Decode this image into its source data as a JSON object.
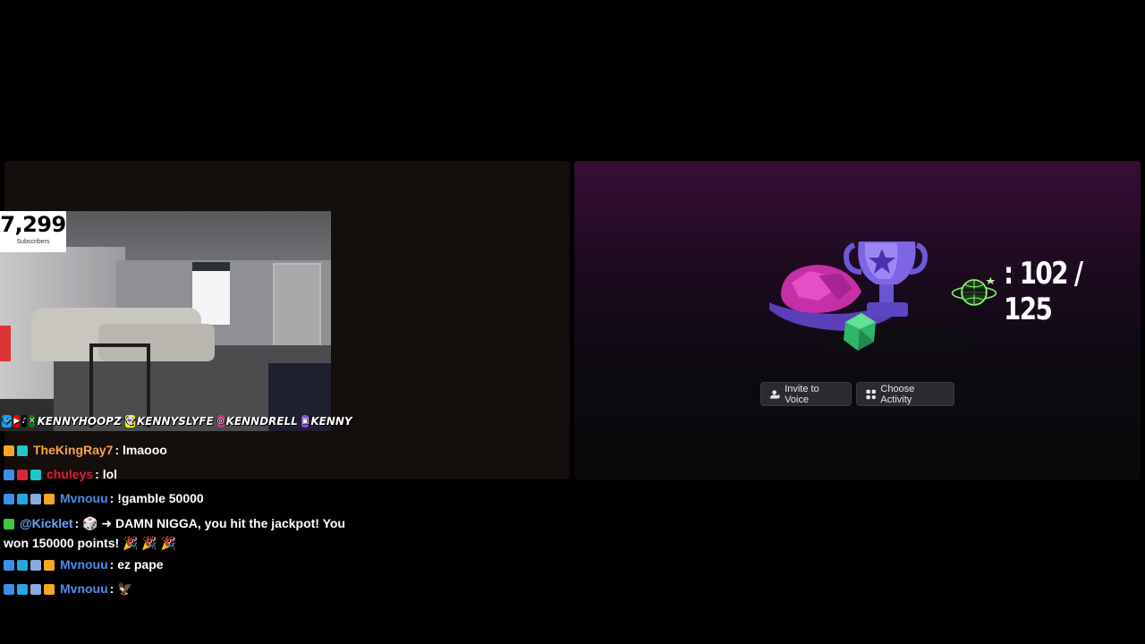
{
  "stream": {
    "subscribers": {
      "count": "7,299",
      "label": "Subscribers"
    },
    "socials": [
      {
        "icon": "twitter-icon",
        "color": "#1da1f2",
        "glyph": "🐦"
      },
      {
        "icon": "youtube-icon",
        "color": "#ff0000",
        "glyph": "▶"
      },
      {
        "icon": "tiktok-icon",
        "color": "#000000",
        "glyph": "♪"
      },
      {
        "icon": "xbox-icon",
        "color": "#107c10",
        "glyph": "✕",
        "handle": "KENNYHOOPZ"
      },
      {
        "icon": "snapchat-icon",
        "color": "#fffc00",
        "glyph": "👻",
        "handle": "KENNYSLYFE"
      },
      {
        "icon": "instagram-icon",
        "color": "#c13584",
        "glyph": "◎",
        "handle": "KENNDRELL"
      },
      {
        "icon": "twitch-icon",
        "color": "#9146ff",
        "glyph": "▣",
        "handle": "KENNY"
      }
    ]
  },
  "chat": [
    {
      "badges": [
        "#f5a623",
        "#1ec8c8"
      ],
      "badge_icons": [
        "sub-badge-icon",
        "gift-badge-icon"
      ],
      "user": "TheKingRay7",
      "color": "#f6a54a",
      "message": ": lmaooo"
    },
    {
      "badges": [
        "#3a8ee6",
        "#d9263a",
        "#1ec8c8"
      ],
      "badge_icons": [
        "prime-badge-icon",
        "bits-badge-icon",
        "gift-badge-icon"
      ],
      "user": "chuleys",
      "color": "#e21c2d",
      "message": ": lol"
    },
    {
      "badges": [
        "#3a8ee6",
        "#26a6e0",
        "#8ad",
        "#f5a623"
      ],
      "badge_icons": [
        "prime-badge-icon",
        "cube-badge-icon",
        "gem-badge-icon",
        "crown-badge-icon"
      ],
      "user": "Mvnouu",
      "color": "#4b8ee8",
      "message": ": !gamble 50000"
    },
    {
      "badges": [
        "#3fc63f"
      ],
      "badge_icons": [
        "verified-badge-icon"
      ],
      "user": "@Kicklet",
      "color": "#6aa6f0",
      "message": ": 🎲 ➜ DAMN NIGGA, you hit the jackpot! You won 150000 points! 🎉 🎉 🎉"
    },
    {
      "badges": [
        "#3a8ee6",
        "#26a6e0",
        "#8ad",
        "#f5a623"
      ],
      "badge_icons": [
        "prime-badge-icon",
        "cube-badge-icon",
        "gem-badge-icon",
        "crown-badge-icon"
      ],
      "user": "Mvnouu",
      "color": "#4b8ee8",
      "message": ": ez pape"
    },
    {
      "badges": [
        "#3a8ee6",
        "#26a6e0",
        "#8ad",
        "#f5a623"
      ],
      "badge_icons": [
        "prime-badge-icon",
        "cube-badge-icon",
        "gem-badge-icon",
        "crown-badge-icon"
      ],
      "user": "Mvnouu",
      "color": "#4b8ee8",
      "message": ": 🦅"
    }
  ],
  "activity": {
    "counter": ": 102 / 125",
    "invite_label": "Invite to Voice",
    "choose_label": "Choose Activity"
  }
}
